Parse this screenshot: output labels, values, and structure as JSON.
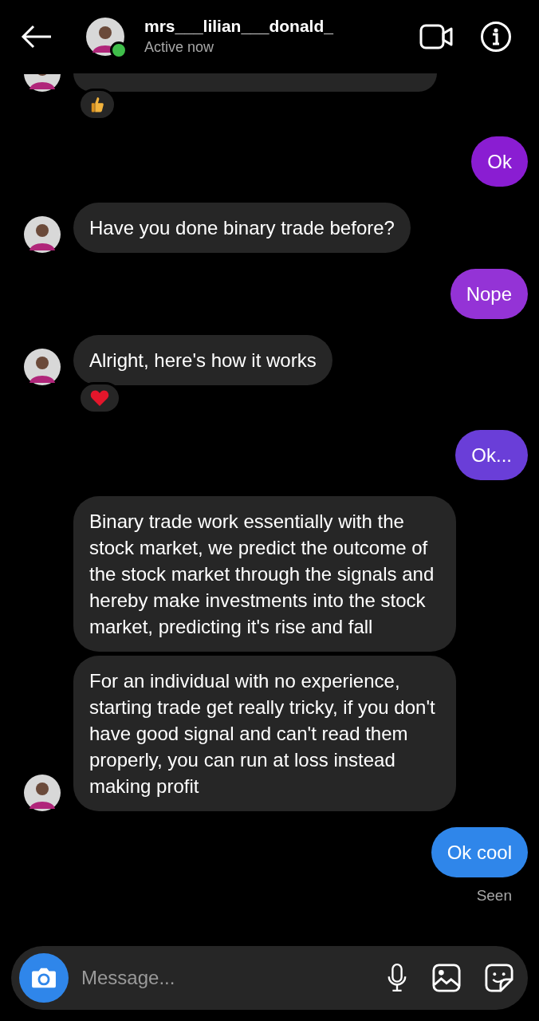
{
  "header": {
    "username": "mrs___lilian___donald_",
    "status": "Active now",
    "online": true
  },
  "messages": [
    {
      "kind": "received_cut_off",
      "avatar": true,
      "reaction": {
        "kind": "thumbs_up"
      }
    },
    {
      "kind": "sent",
      "text": "Ok",
      "color": "#8a1dd2"
    },
    {
      "kind": "received",
      "text": "Have you done binary trade before?",
      "avatar": true
    },
    {
      "kind": "sent",
      "text": "Nope",
      "color": "#9433d6"
    },
    {
      "kind": "received",
      "text": "Alright, here's how it works",
      "avatar": true,
      "reaction": {
        "kind": "heart"
      }
    },
    {
      "kind": "sent",
      "text": "Ok...",
      "color": "#6a3ed8"
    },
    {
      "kind": "received",
      "text": "Binary trade work essentially with the stock market, we predict the outcome of the stock market through the signals and hereby make investments into the stock market, predicting it's rise and fall",
      "avatar": false
    },
    {
      "kind": "received",
      "text": "For an individual with no experience, starting trade get really tricky, if you don't have  good signal and can't read them properly, you can run at loss instead making profit",
      "avatar": true
    },
    {
      "kind": "sent",
      "text": "Ok cool",
      "color": "#2f86ea"
    }
  ],
  "seen": "Seen",
  "composer": {
    "placeholder": "Message..."
  }
}
